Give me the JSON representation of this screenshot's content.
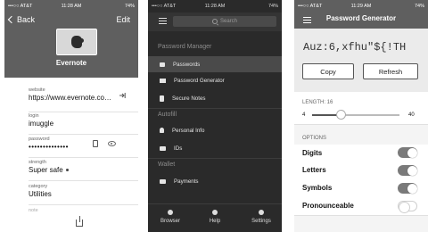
{
  "screen1": {
    "status": {
      "carrier": "•••○○ AT&T",
      "time": "11:28 AM",
      "battery": "74%"
    },
    "back_label": "Back",
    "edit_label": "Edit",
    "logo_icon": "evernote-logo-icon",
    "title": "Evernote",
    "fields": [
      {
        "label": "website",
        "value": "https://www.evernote.com/logi..."
      },
      {
        "label": "login",
        "value": "imuggle"
      },
      {
        "label": "password",
        "value": "••••••••••••••"
      },
      {
        "label": "strength",
        "value": "Super safe"
      },
      {
        "label": "category",
        "value": "Utilities"
      },
      {
        "label": "note",
        "value": ""
      }
    ]
  },
  "screen2": {
    "status": {
      "carrier": "•••○○ AT&T",
      "time": "11:28 AM",
      "battery": "74%"
    },
    "search_placeholder": "Search",
    "section_password_manager": "Password Manager",
    "pm_items": [
      "Passwords",
      "Password Generator",
      "Secure Notes"
    ],
    "section_autofill": "Autofill",
    "autofill_items": [
      "Personal Info",
      "IDs"
    ],
    "section_wallet": "Wallet",
    "wallet_items": [
      "Payments"
    ],
    "tabs": [
      "Browser",
      "Help",
      "Settings"
    ]
  },
  "screen3": {
    "status": {
      "carrier": "•••○○ AT&T",
      "time": "11:29 AM",
      "battery": "74%"
    },
    "title": "Password Generator",
    "generated_password": "Auz:6,xfhu\"${!TH",
    "copy_label": "Copy",
    "refresh_label": "Refresh",
    "length_label": "LENGTH: 16",
    "slider_min": "4",
    "slider_max": "40",
    "slider_value": 16,
    "options_header": "OPTIONS",
    "options": [
      {
        "label": "Digits",
        "enabled": true
      },
      {
        "label": "Letters",
        "enabled": true
      },
      {
        "label": "Symbols",
        "enabled": true
      },
      {
        "label": "Pronounceable",
        "enabled": false
      }
    ]
  }
}
